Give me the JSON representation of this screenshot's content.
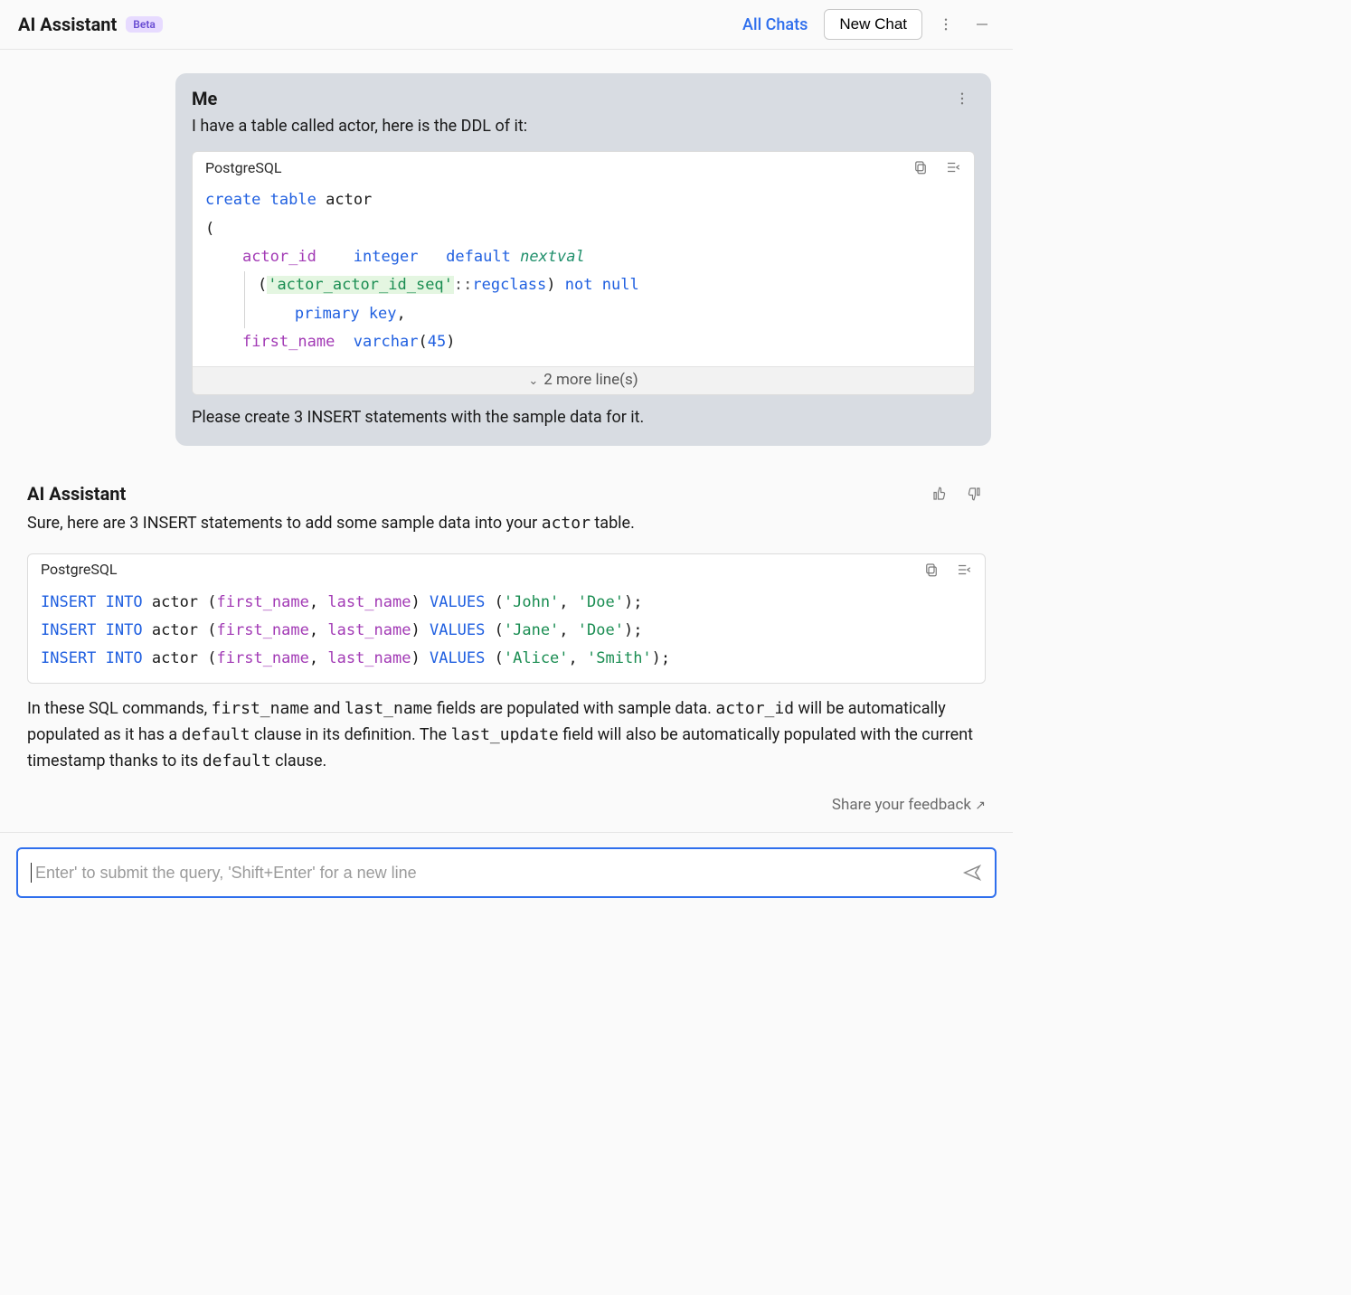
{
  "header": {
    "title": "AI Assistant",
    "badge": "Beta",
    "all_chats": "All Chats",
    "new_chat": "New Chat"
  },
  "user_msg": {
    "author": "Me",
    "intro": "I have a table called actor, here is the DDL of it:",
    "code_lang": "PostgreSQL",
    "ddl": {
      "create": "create",
      "table": "table",
      "name": "actor",
      "open": "(",
      "col1_name": "actor_id",
      "col1_type": "integer",
      "default_kw": "default",
      "nextval": "nextval",
      "seq_open": "(",
      "seq_str": "'actor_actor_id_seq'",
      "cast": "::",
      "regclass": "regclass",
      "seq_close": ")",
      "not_kw": "not",
      "null_kw": "null",
      "primary": "primary",
      "key": "key",
      "comma": ",",
      "col2_name": "first_name",
      "varchar": "varchar",
      "len_open": "(",
      "len": "45",
      "len_close": ")"
    },
    "more_lines": "2 more line(s)",
    "outro": "Please create 3 INSERT statements with the sample data for it."
  },
  "ai_msg": {
    "author": "AI Assistant",
    "reply_before": "Sure, here are 3 INSERT statements to add some sample data into your ",
    "reply_mono": "actor",
    "reply_after": " table.",
    "code_lang": "PostgreSQL",
    "inserts": [
      {
        "fn": "'John'",
        "ln": "'Doe'"
      },
      {
        "fn": "'Jane'",
        "ln": "'Doe'"
      },
      {
        "fn": "'Alice'",
        "ln": "'Smith'"
      }
    ],
    "insert_kw": "INSERT",
    "into_kw": "INTO",
    "tbl": "actor",
    "open": "(",
    "c1": "first_name",
    "sep": ",",
    "c2": "last_name",
    "close": ")",
    "values_kw": "VALUES",
    "vopen": "(",
    "vsep": ",",
    "vclose": ")",
    "term": ";",
    "explain_1a": "In these SQL commands, ",
    "explain_1b": "first_name",
    "explain_1c": " and ",
    "explain_1d": "last_name",
    "explain_1e": " fields are populated with sample data. ",
    "explain_1f": "actor_id",
    "explain_1g": " will be automatically populated as it has a ",
    "explain_1h": "default",
    "explain_1i": " clause in its definition. The ",
    "explain_1j": "last_update",
    "explain_1k": " field will also be automatically populated with the current timestamp thanks to its ",
    "explain_1l": "default",
    "explain_1m": " clause."
  },
  "feedback": "Share your feedback",
  "input": {
    "placeholder": "Enter' to submit the query, 'Shift+Enter' for a new line"
  }
}
